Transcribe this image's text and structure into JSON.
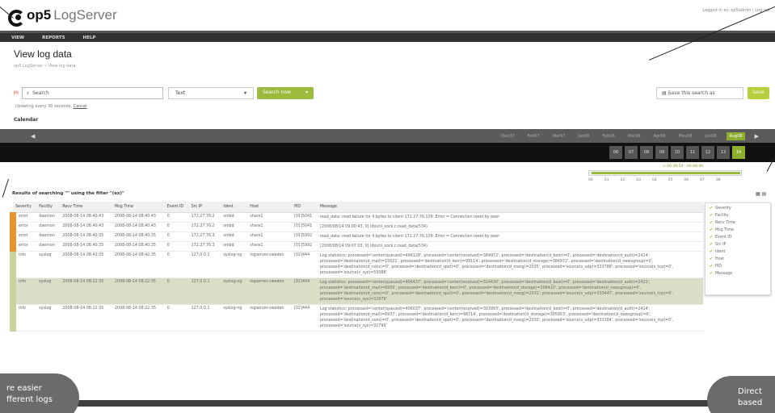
{
  "app": {
    "logo_bold": "op5",
    "logo_light": "LogServer",
    "top_right": "Logged in as: op5admin | Log out"
  },
  "nav": {
    "items": [
      "VIEW",
      "REPORTS",
      "HELP"
    ]
  },
  "page": {
    "title": "View log data",
    "breadcrumb": "op5 LogServer » View log data"
  },
  "search": {
    "value": "Search",
    "mode": "Text",
    "button": "Search now",
    "status": "Updating every 30 seconds.",
    "cancel": "Cancel",
    "save_placeholder": "Save this search as",
    "save_button": "Save"
  },
  "calendar": {
    "label": "Calendar",
    "months": [
      "Dec07",
      "Feb07",
      "Mar07",
      "Jan08",
      "Feb08",
      "Mar08",
      "Apr08",
      "May08",
      "Jun08",
      "Aug08"
    ],
    "active_month": "Aug08",
    "days": [
      "06",
      "07",
      "08",
      "09",
      "10",
      "11",
      "12",
      "13",
      "14"
    ],
    "active_day": "14",
    "time_range": "> 00:49:54 - 00:48:40",
    "ticks": [
      "00",
      "01",
      "02",
      "03",
      "04",
      "05",
      "06",
      "07",
      "08"
    ]
  },
  "results": {
    "title": "Results of searching \"\" using the filter \"(ex)\""
  },
  "table": {
    "columns": [
      "Severity",
      "Facility",
      "Recv Time",
      "Msg Time",
      "Event ID",
      "Src IP",
      "Ident",
      "Host",
      "PID",
      "Message"
    ],
    "rows": [
      {
        "sev": "error",
        "fac": "daemon",
        "recv": "2008-08-14 08:40:43",
        "msg": "2008-08-14 08:40:43",
        "ev": "0",
        "ip": "172.27.76.2",
        "ident": "smbd",
        "host": "share1",
        "pid": "[01]5041",
        "text": "read_data: read failure for 4 bytes to client 172.27.76.109. Error = Connection reset by peer"
      },
      {
        "sev": "error",
        "fac": "daemon",
        "recv": "2008-08-14 08:40:43",
        "msg": "2008-08-14 08:40:43",
        "ev": "0",
        "ip": "172.27.76.2",
        "ident": "smbd",
        "host": "share1",
        "pid": "[01]5041",
        "text": "[2008/08/14 09:00:43, 0] lib/util_sock.c:read_data(534)"
      },
      {
        "sev": "error",
        "fac": "daemon",
        "recv": "2008-08-14 08:40:35",
        "msg": "2008-08-14 08:40:35",
        "ev": "0",
        "ip": "172.27.76.3",
        "ident": "smbd",
        "host": "share1",
        "pid": "[01]5992",
        "text": "read_data: read failure for 4 bytes to client 172.27.76.109. Error = Connection reset by peer"
      },
      {
        "sev": "error",
        "fac": "daemon",
        "recv": "2008-08-14 08:40:35",
        "msg": "2008-08-14 08:40:35",
        "ev": "0",
        "ip": "172.27.76.3",
        "ident": "smbd",
        "host": "share1",
        "pid": "[01]5992",
        "text": "[2008/08/14 09:07:03, 0] lib/util_sock.c:read_data(534)"
      },
      {
        "sev": "info",
        "fac": "syslog",
        "recv": "2008-08-14 08:42:35",
        "msg": "2008-08-14 08:42:35",
        "ev": "0",
        "ip": "127.0.0.1",
        "ident": "syslog-ng",
        "host": "logserver-sweden",
        "pid": "[02]444",
        "text": "Log statistics; processed='center(queued)=496128', processed='center(received)=384972', processed='destination(d_boot)=0', processed='destination(d_auth)=2414', processed='destination(d_mail)=15021', processed='destination(d_kern)=99114', processed='destination(d_storage)=384972', processed='destination(d_newsgroup)=0', processed='destination(d_cons)=0', processed='destination(d_spol)=0', processed='destination(d_mesg)=2035', processed='source(s_udp)=333788', processed='source(s_tcp)=0', processed='source(s_sys)=59388'"
      },
      {
        "sev": "info",
        "fac": "syslog",
        "recv": "2008-08-14 08:22:35",
        "msg": "2008-08-14 08:22:35",
        "ev": "0",
        "ip": "127.0.0.1",
        "ident": "syslog-ng",
        "host": "logserver-sweden",
        "pid": "[02]444",
        "text": "Log statistics; processed='center(queued)=406437', processed='center(received)=324430', processed='destination(d_boot)=0', processed='destination(d_auth)=2423', processed='destination(d_mail)=6955', processed='destination(d_kern)=0', processed='destination(d_storage)=306420', processed='destination(d_newsgroup)=0', processed='destination(d_cons)=0', processed='destination(d_spol)=0', processed='destination(d_mesg)=2031', processed='source(s_udp)=333447', processed='source(s_tcp)=0', processed='source(s_sys)=32979'"
      },
      {
        "sev": "info",
        "fac": "syslog",
        "recv": "2008-08-14 08:22:35",
        "msg": "2008-08-14 08:22:35",
        "ev": "0",
        "ip": "127.0.0.1",
        "ident": "syslog-ng",
        "host": "logserver-sweden",
        "pid": "[02]444",
        "text": "Log statistics; processed='center(queued)=406037', processed='center(received)=303993', processed='destination(d_boot)=0', processed='destination(d_auth)=2414', processed='destination(d_mail)=6937', processed='destination(d_kern)=98714', processed='destination(d_storage)=305953', processed='destination(d_newsgroup)=0', processed='destination(d_cons)=0', processed='destination(d_spol)=0', processed='destination(d_mesg)=2030', processed='source(s_udp)=331384', processed='source(s_tcp)=0', processed='source(s_sys)=32799'"
      }
    ]
  },
  "column_panel": {
    "items": [
      "Severity",
      "Facility",
      "Recv Time",
      "Msg Time",
      "Event ID",
      "Src IP",
      "Ident",
      "Host",
      "PID",
      "Message"
    ]
  },
  "callouts": {
    "left_line1": "re easier",
    "left_line2": "fferent logs",
    "right_line1": "Direct",
    "right_line2": "based"
  },
  "colors": {
    "accent": "#9cba3d",
    "error": "#e5952f",
    "nav": "#323232"
  }
}
